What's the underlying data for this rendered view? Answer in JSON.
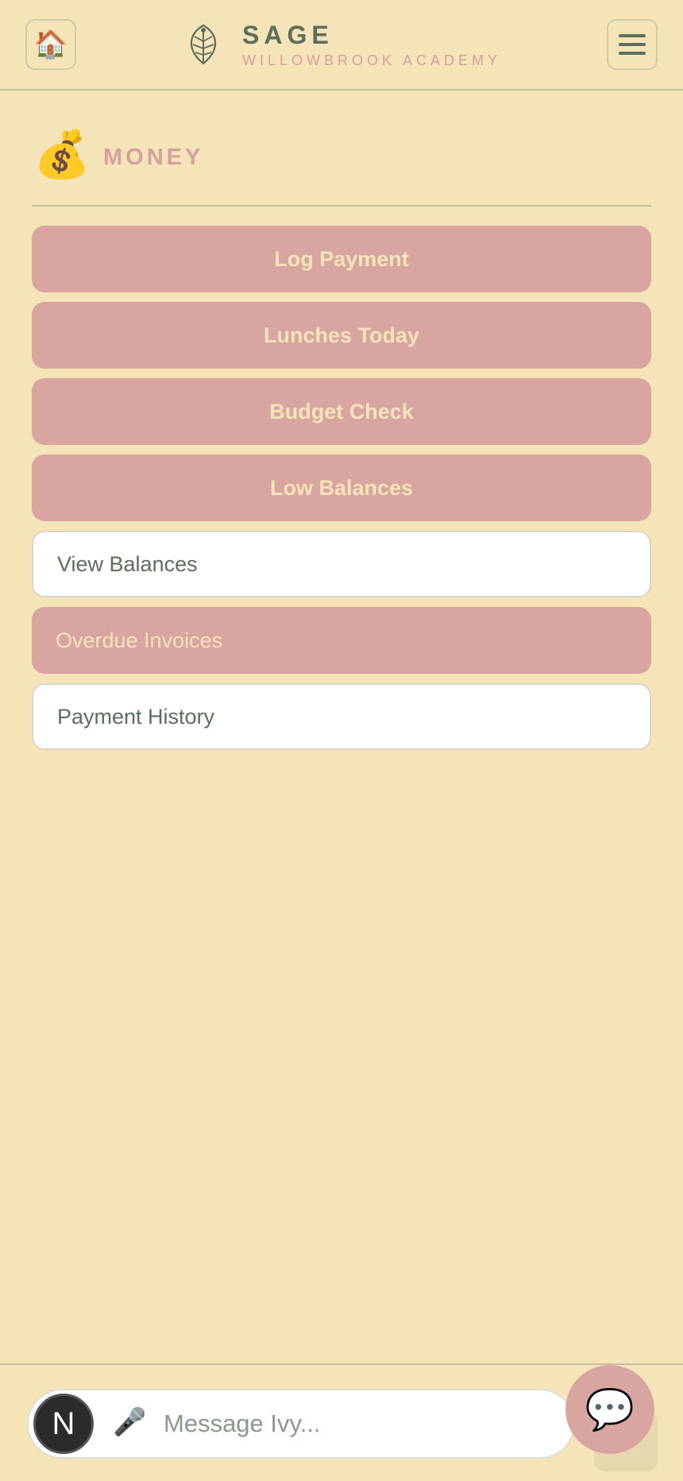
{
  "header": {
    "home_icon": "🏠",
    "brand_name": "SAGE",
    "brand_subtitle": "WILLOWBROOK ACADEMY",
    "logo_icon": "leaf-icon",
    "menu_icon": "hamburger-icon"
  },
  "section": {
    "icon": "💰",
    "title": "MONEY"
  },
  "actions": [
    {
      "label": "Log Payment",
      "style": "primary"
    },
    {
      "label": "Lunches Today",
      "style": "primary"
    },
    {
      "label": "Budget Check",
      "style": "primary"
    },
    {
      "label": "Low Balances",
      "style": "primary"
    },
    {
      "label": "View Balances",
      "style": "plain"
    },
    {
      "label": "Overdue Invoices",
      "style": "alert"
    },
    {
      "label": "Payment History",
      "style": "plain"
    }
  ],
  "composer": {
    "avatar_letter": "N",
    "mic_icon": "🎤",
    "placeholder": "Message Ivy...",
    "chat_icon": "💬"
  },
  "colors": {
    "background": "#f4e4b8",
    "accent": "#d9a5a0",
    "text": "#5c6e5c"
  }
}
